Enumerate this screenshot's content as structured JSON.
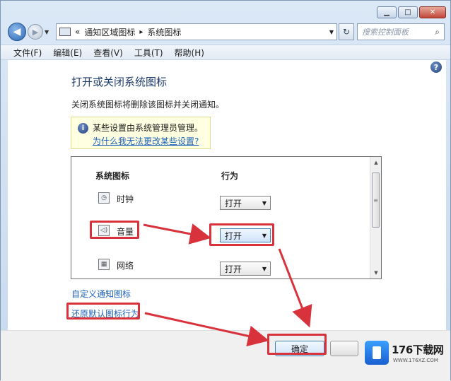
{
  "address": {
    "back_arrow": "◀",
    "overflow": "«",
    "crumb1": "通知区域图标",
    "separator": "▸",
    "crumb2": "系统图标",
    "search_placeholder": "搜索控制面板"
  },
  "menu": [
    "文件(F)",
    "编辑(E)",
    "查看(V)",
    "工具(T)",
    "帮助(H)"
  ],
  "content": {
    "title": "打开或关闭系统图标",
    "description": "关闭系统图标将删除该图标并关闭通知。",
    "info_text": "某些设置由系统管理员管理。",
    "info_link": "为什么我无法更改某些设置?",
    "col_icon": "系统图标",
    "col_behavior": "行为",
    "rows": [
      {
        "label": "时钟",
        "value": "打开"
      },
      {
        "label": "音量",
        "value": "打开"
      },
      {
        "label": "网络",
        "value": "打开"
      }
    ],
    "link_customize": "自定义通知图标",
    "link_restore": "还原默认图标行为"
  },
  "buttons": {
    "ok": "确定"
  },
  "watermark": {
    "name": "176下载网",
    "url": "WWW.176XZ.COM"
  },
  "colors": {
    "highlight": "#d8323c",
    "link": "#1d62b6"
  }
}
